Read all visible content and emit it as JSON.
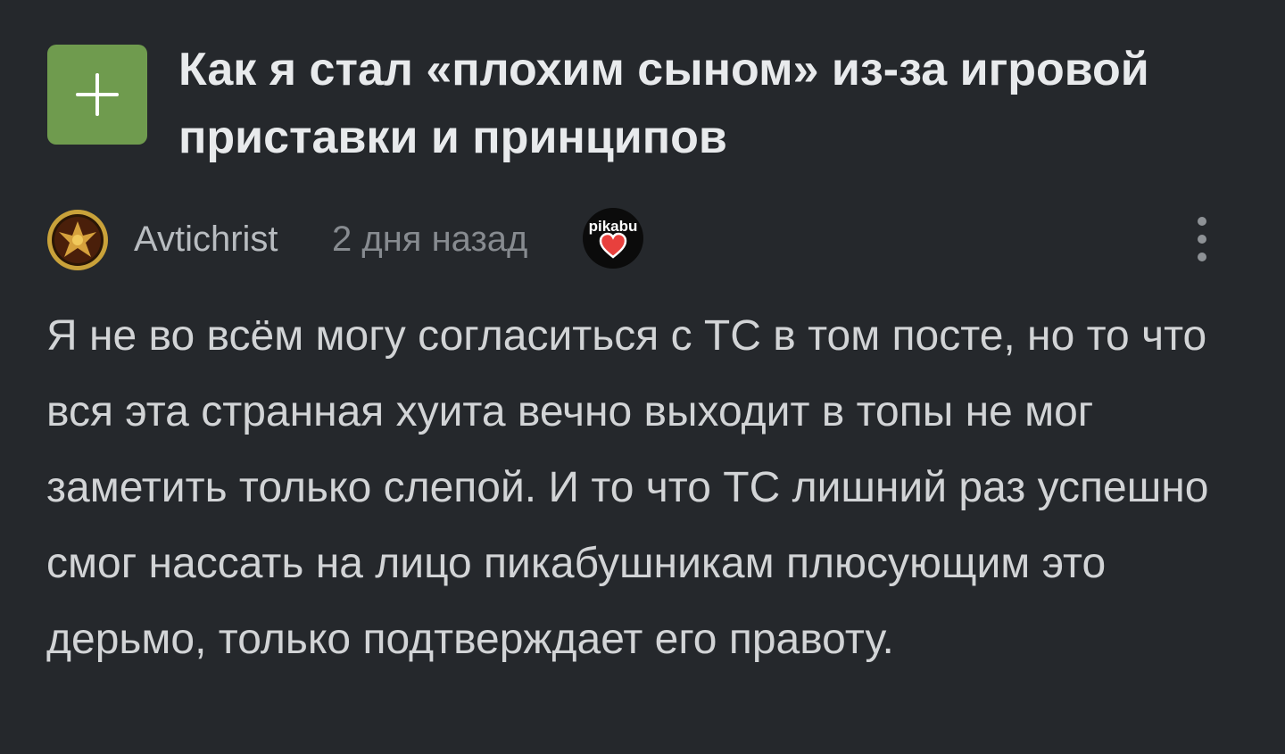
{
  "post": {
    "title": "Как я стал «плохим сыном» из-за игровой приставки и принципов",
    "add_icon": "plus-icon"
  },
  "comment": {
    "author": "Avtichrist",
    "time": "2 дня назад",
    "badge_text": "pikabu",
    "badge_icon": "pikabu-heart-badge-icon",
    "menu_icon": "more-vertical-icon",
    "body": "Я не во всём могу согласиться с ТС в том посте, но то что вся эта странная хуита вечно выходит в топы не мог заметить только слепой. И то что ТС лишний раз успешно смог нассать на лицо пикабушникам плюсующим это дерьмо, только подтверждает его правоту."
  },
  "colors": {
    "background": "#25282c",
    "add_button": "#6f9b4e",
    "heart": "#e8403d"
  }
}
